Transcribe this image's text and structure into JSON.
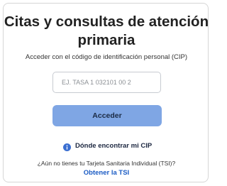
{
  "card": {
    "title": "Citas y consultas de atención primaria",
    "subtitle": "Acceder con el código de identificación personal (CIP)"
  },
  "cip_field": {
    "value": "",
    "placeholder": "EJ. TASA 1 032101 00 2"
  },
  "access_button": {
    "label": "Acceder"
  },
  "help": {
    "icon": "info-icon",
    "label": "Dónde encontrar mi CIP"
  },
  "tsi": {
    "question": "¿Aún no tienes tu Tarjeta Sanitaria Individual (TSI)?",
    "link_label": "Obtener la TSI"
  },
  "colors": {
    "button_background": "#7fa6e4",
    "link": "#1a5bc4",
    "info_icon": "#3b6fd1",
    "title_text": "#222222"
  }
}
